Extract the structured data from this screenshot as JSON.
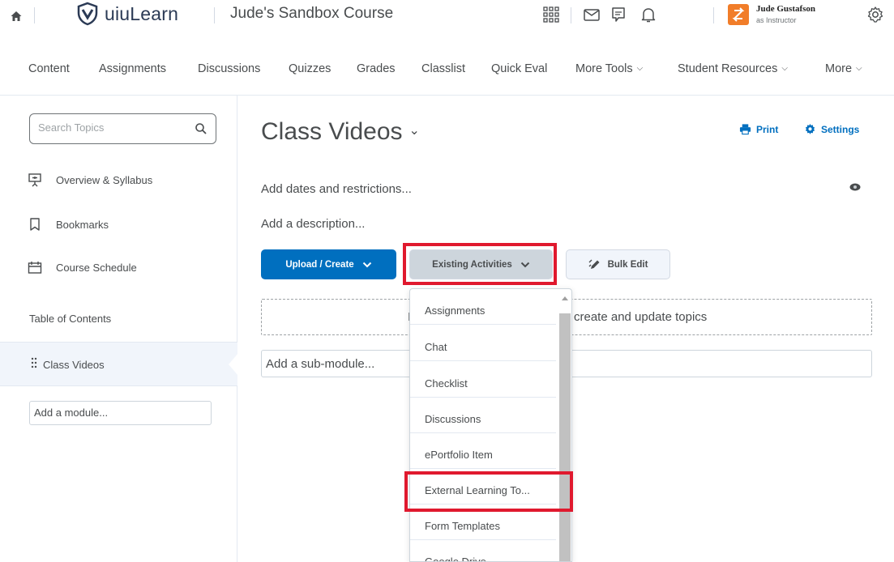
{
  "topbar": {
    "brand": "uiuLearn",
    "course": "Jude's Sandbox Course",
    "user_name": "Jude Gustafson",
    "user_role": "as Instructor",
    "avatar_color": "#f17d29"
  },
  "nav": {
    "items": [
      {
        "label": "Content"
      },
      {
        "label": "Assignments"
      },
      {
        "label": "Discussions"
      },
      {
        "label": "Quizzes"
      },
      {
        "label": "Grades"
      },
      {
        "label": "Classlist"
      },
      {
        "label": "Quick Eval"
      },
      {
        "label": "More Tools"
      },
      {
        "label": "Student Resources"
      },
      {
        "label": "More"
      }
    ]
  },
  "sidebar": {
    "search_placeholder": "Search Topics",
    "items": [
      {
        "label": "Overview & Syllabus",
        "icon": "presentation-icon"
      },
      {
        "label": "Bookmarks",
        "icon": "bookmark-icon"
      },
      {
        "label": "Course Schedule",
        "icon": "calendar-icon"
      }
    ],
    "toc_label": "Table of Contents",
    "active_module": "Class Videos",
    "add_module": "Add a module..."
  },
  "main": {
    "title": "Class Videos",
    "print_label": "Print",
    "settings_label": "Settings",
    "dates_link": "Add dates and restrictions...",
    "description_link": "Add a description...",
    "upload_label": "Upload / Create",
    "existing_label": "Existing Activities",
    "bulk_edit_label": "Bulk Edit",
    "dropzone_text": "create and update topics",
    "dropzone_prefix": "I",
    "sub_module": "Add a sub-module..."
  },
  "dropdown": {
    "items": [
      {
        "label": "Assignments"
      },
      {
        "label": "Chat"
      },
      {
        "label": "Checklist"
      },
      {
        "label": "Discussions"
      },
      {
        "label": "ePortfolio Item"
      },
      {
        "label": "External Learning To..."
      },
      {
        "label": "Form Templates"
      },
      {
        "label": "Google Drive"
      }
    ]
  },
  "colors": {
    "accent": "#006fbf",
    "highlight": "#e0192e"
  }
}
